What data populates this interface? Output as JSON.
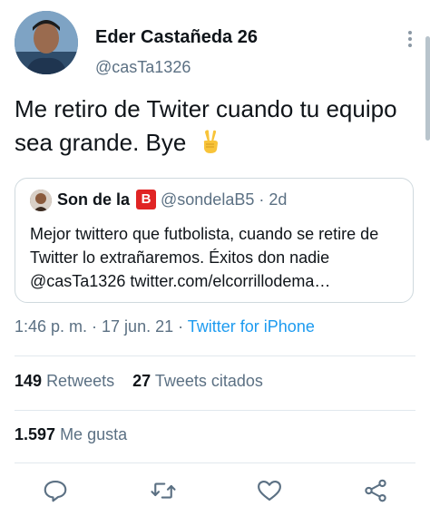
{
  "author": {
    "name": "Eder Castañeda 26",
    "handle": "@casTa1326"
  },
  "tweet": {
    "text": "Me retiro de Twiter cuando tu equipo sea grande. Bye",
    "emoji": "victory-hand-emoji"
  },
  "quote": {
    "name": "Son de la",
    "badge": "B",
    "handle": "@sondelaB5 · 2d",
    "text": "Mejor twittero que futbolista, cuando se retire de Twitter lo extrañaremos. Éxitos don nadie @casTa1326 twitter.com/elcorrillodema…"
  },
  "meta": {
    "time_date": "1:46 p. m. · 17 jun. 21 · ",
    "source": "Twitter for iPhone"
  },
  "stats": {
    "retweets_count": "149",
    "retweets_label": "Retweets",
    "quotes_count": "27",
    "quotes_label": "Tweets citados",
    "likes_count": "1.597",
    "likes_label": "Me gusta"
  },
  "actions": [
    "reply-icon",
    "retweet-icon",
    "like-icon",
    "share-icon"
  ],
  "colors": {
    "link": "#1d9bf0",
    "secondary_text": "#5b7083",
    "badge": "#e02424"
  }
}
